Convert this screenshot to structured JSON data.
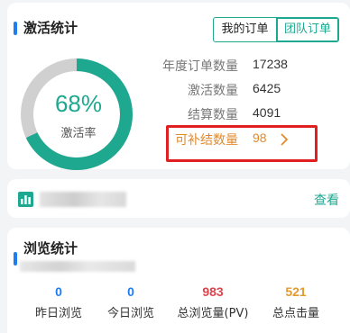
{
  "activation": {
    "title": "激活统计",
    "tabs": [
      {
        "label": "我的订单",
        "active": false
      },
      {
        "label": "团队订单",
        "active": true
      }
    ],
    "gauge": {
      "percent_text": "68%",
      "fraction": 0.68,
      "label": "激活率"
    },
    "stats": [
      {
        "label": "年度订单数量",
        "value": "17238"
      },
      {
        "label": "激活数量",
        "value": "6425"
      },
      {
        "label": "结算数量",
        "value": "4091"
      },
      {
        "label": "可补结数量",
        "value": "98"
      }
    ],
    "more_icon": "chevron-right-icon"
  },
  "view_card": {
    "icon": "bar-chart-icon",
    "link": "查看"
  },
  "browse": {
    "title": "浏览统计",
    "metrics": [
      {
        "value": "0",
        "label": "昨日浏览",
        "color": "#1e7ef0"
      },
      {
        "value": "0",
        "label": "今日浏览",
        "color": "#1e7ef0"
      },
      {
        "value": "983",
        "label": "总浏览量(PV)",
        "color": "#e0434b"
      },
      {
        "value": "521",
        "label": "总点击量",
        "color": "#e39a2e"
      }
    ]
  },
  "colors": {
    "accent": "#1fa890",
    "gauge_track": "#d0d0d0",
    "highlight": "#e02020",
    "orange": "#e08a2c"
  }
}
